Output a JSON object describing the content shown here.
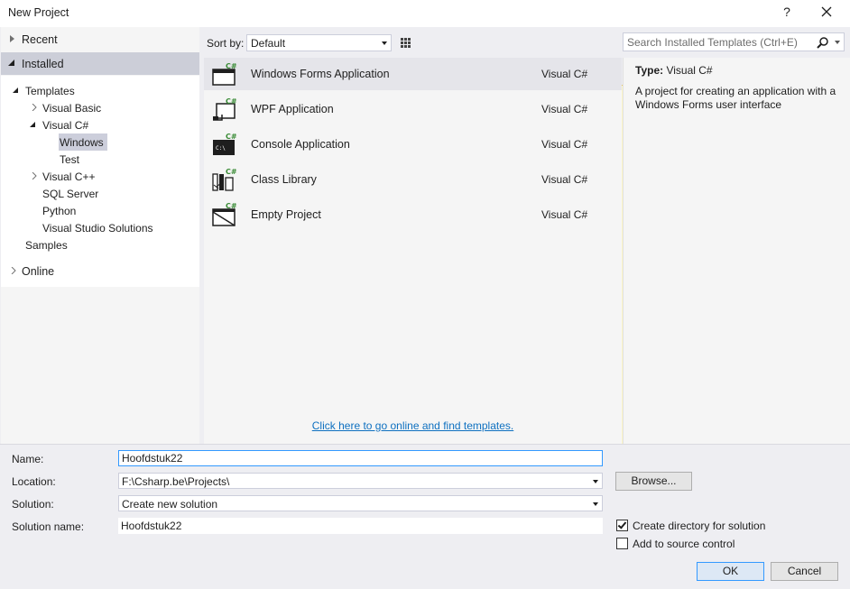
{
  "window": {
    "title": "New Project",
    "help_label": "?"
  },
  "tree": {
    "recent": "Recent",
    "installed": "Installed",
    "templates": "Templates",
    "visual_basic": "Visual Basic",
    "visual_csharp": "Visual C#",
    "windows": "Windows",
    "test": "Test",
    "visual_cpp": "Visual C++",
    "sql_server": "SQL Server",
    "python": "Python",
    "vs_solutions": "Visual Studio Solutions",
    "samples": "Samples",
    "online": "Online"
  },
  "sortbar": {
    "label": "Sort by:",
    "selected": "Default",
    "search_placeholder": "Search Installed Templates (Ctrl+E)"
  },
  "templates": [
    {
      "name": "Windows Forms Application",
      "lang": "Visual C#",
      "icon": "winforms-icon"
    },
    {
      "name": "WPF Application",
      "lang": "Visual C#",
      "icon": "wpf-icon"
    },
    {
      "name": "Console Application",
      "lang": "Visual C#",
      "icon": "console-icon"
    },
    {
      "name": "Class Library",
      "lang": "Visual C#",
      "icon": "class-library-icon"
    },
    {
      "name": "Empty Project",
      "lang": "Visual C#",
      "icon": "empty-project-icon"
    }
  ],
  "online_link": "Click here to go online and find templates.",
  "description": {
    "type_label": "Type:",
    "type_value": "Visual C#",
    "text": "A project for creating an application with a Windows Forms user interface"
  },
  "form": {
    "name_label": "Name:",
    "name_value": "Hoofdstuk22",
    "location_label": "Location:",
    "location_value": "F:\\Csharp.be\\Projects\\",
    "solution_label": "Solution:",
    "solution_value": "Create new solution",
    "solution_name_label": "Solution name:",
    "solution_name_value": "Hoofdstuk22",
    "browse": "Browse...",
    "create_dir": "Create directory for solution",
    "create_dir_checked": true,
    "source_control": "Add to source control",
    "source_control_checked": false,
    "ok": "OK",
    "cancel": "Cancel"
  },
  "colors": {
    "accent": "#3399ff",
    "link": "#0e70c0",
    "csharp_badge": "#388a34"
  }
}
